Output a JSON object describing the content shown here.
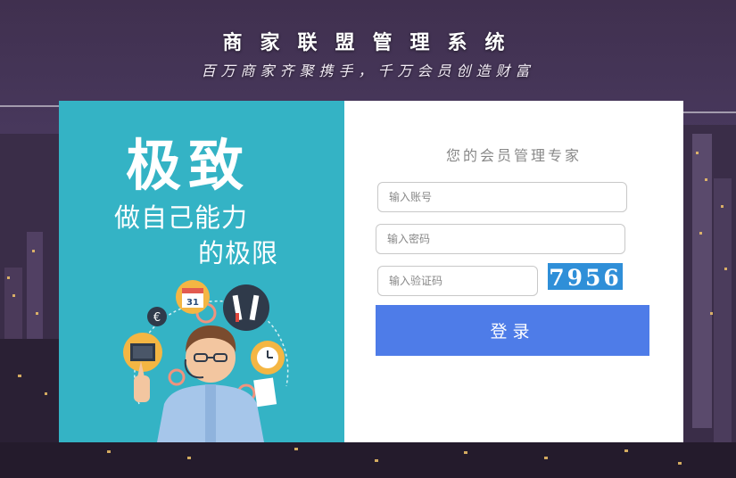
{
  "header": {
    "title": "商家联盟管理系统",
    "subtitle": "百万商家齐聚携手，千万会员创造财富"
  },
  "promo": {
    "headline": "极致",
    "line1": "做自己能力",
    "line2": "的极限",
    "calendar_day": "31",
    "currency_symbol": "€"
  },
  "login": {
    "tagline": "您的会员管理专家",
    "account_placeholder": "输入账号",
    "password_placeholder": "输入密码",
    "captcha_placeholder": "输入验证码",
    "captcha_text": "7956",
    "submit_label": "登录"
  },
  "colors": {
    "promo_bg": "#34b3c5",
    "button_bg": "#4e7ce8",
    "captcha_bg": "#2f8fd8"
  }
}
